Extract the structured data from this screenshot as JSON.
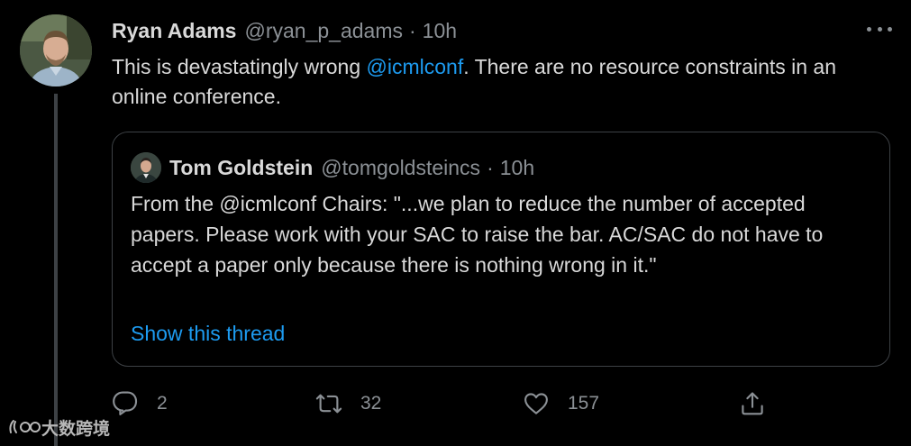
{
  "tweet": {
    "author": {
      "display_name": "Ryan Adams",
      "handle": "@ryan_p_adams"
    },
    "separator": "·",
    "time": "10h",
    "text_before_mention": "This is devastatingly wrong ",
    "mention": "@icmlconf",
    "text_after_mention": ".  There are no resource constraints in an online conference.",
    "more_icon": "more-horizontal-icon"
  },
  "quoted_tweet": {
    "author": {
      "display_name": "Tom Goldstein",
      "handle": "@tomgoldsteincs"
    },
    "separator": "·",
    "time": "10h",
    "text": "From the @icmlconf Chairs: \"...we plan to reduce the number of accepted papers. Please work with your SAC to raise the bar. AC/SAC do not have to accept a paper only because there is nothing wrong in it.\"",
    "show_thread_label": "Show this thread"
  },
  "actions": {
    "reply": {
      "icon": "reply-icon",
      "count": "2"
    },
    "retweet": {
      "icon": "retweet-icon",
      "count": "32"
    },
    "like": {
      "icon": "heart-icon",
      "count": "157"
    },
    "share": {
      "icon": "share-icon"
    }
  },
  "watermark": {
    "text": "大数跨境"
  },
  "colors": {
    "background": "#000000",
    "text_primary": "#d9d9d9",
    "text_secondary": "#8b9095",
    "link": "#1d9bf0",
    "border": "#3d4145"
  }
}
